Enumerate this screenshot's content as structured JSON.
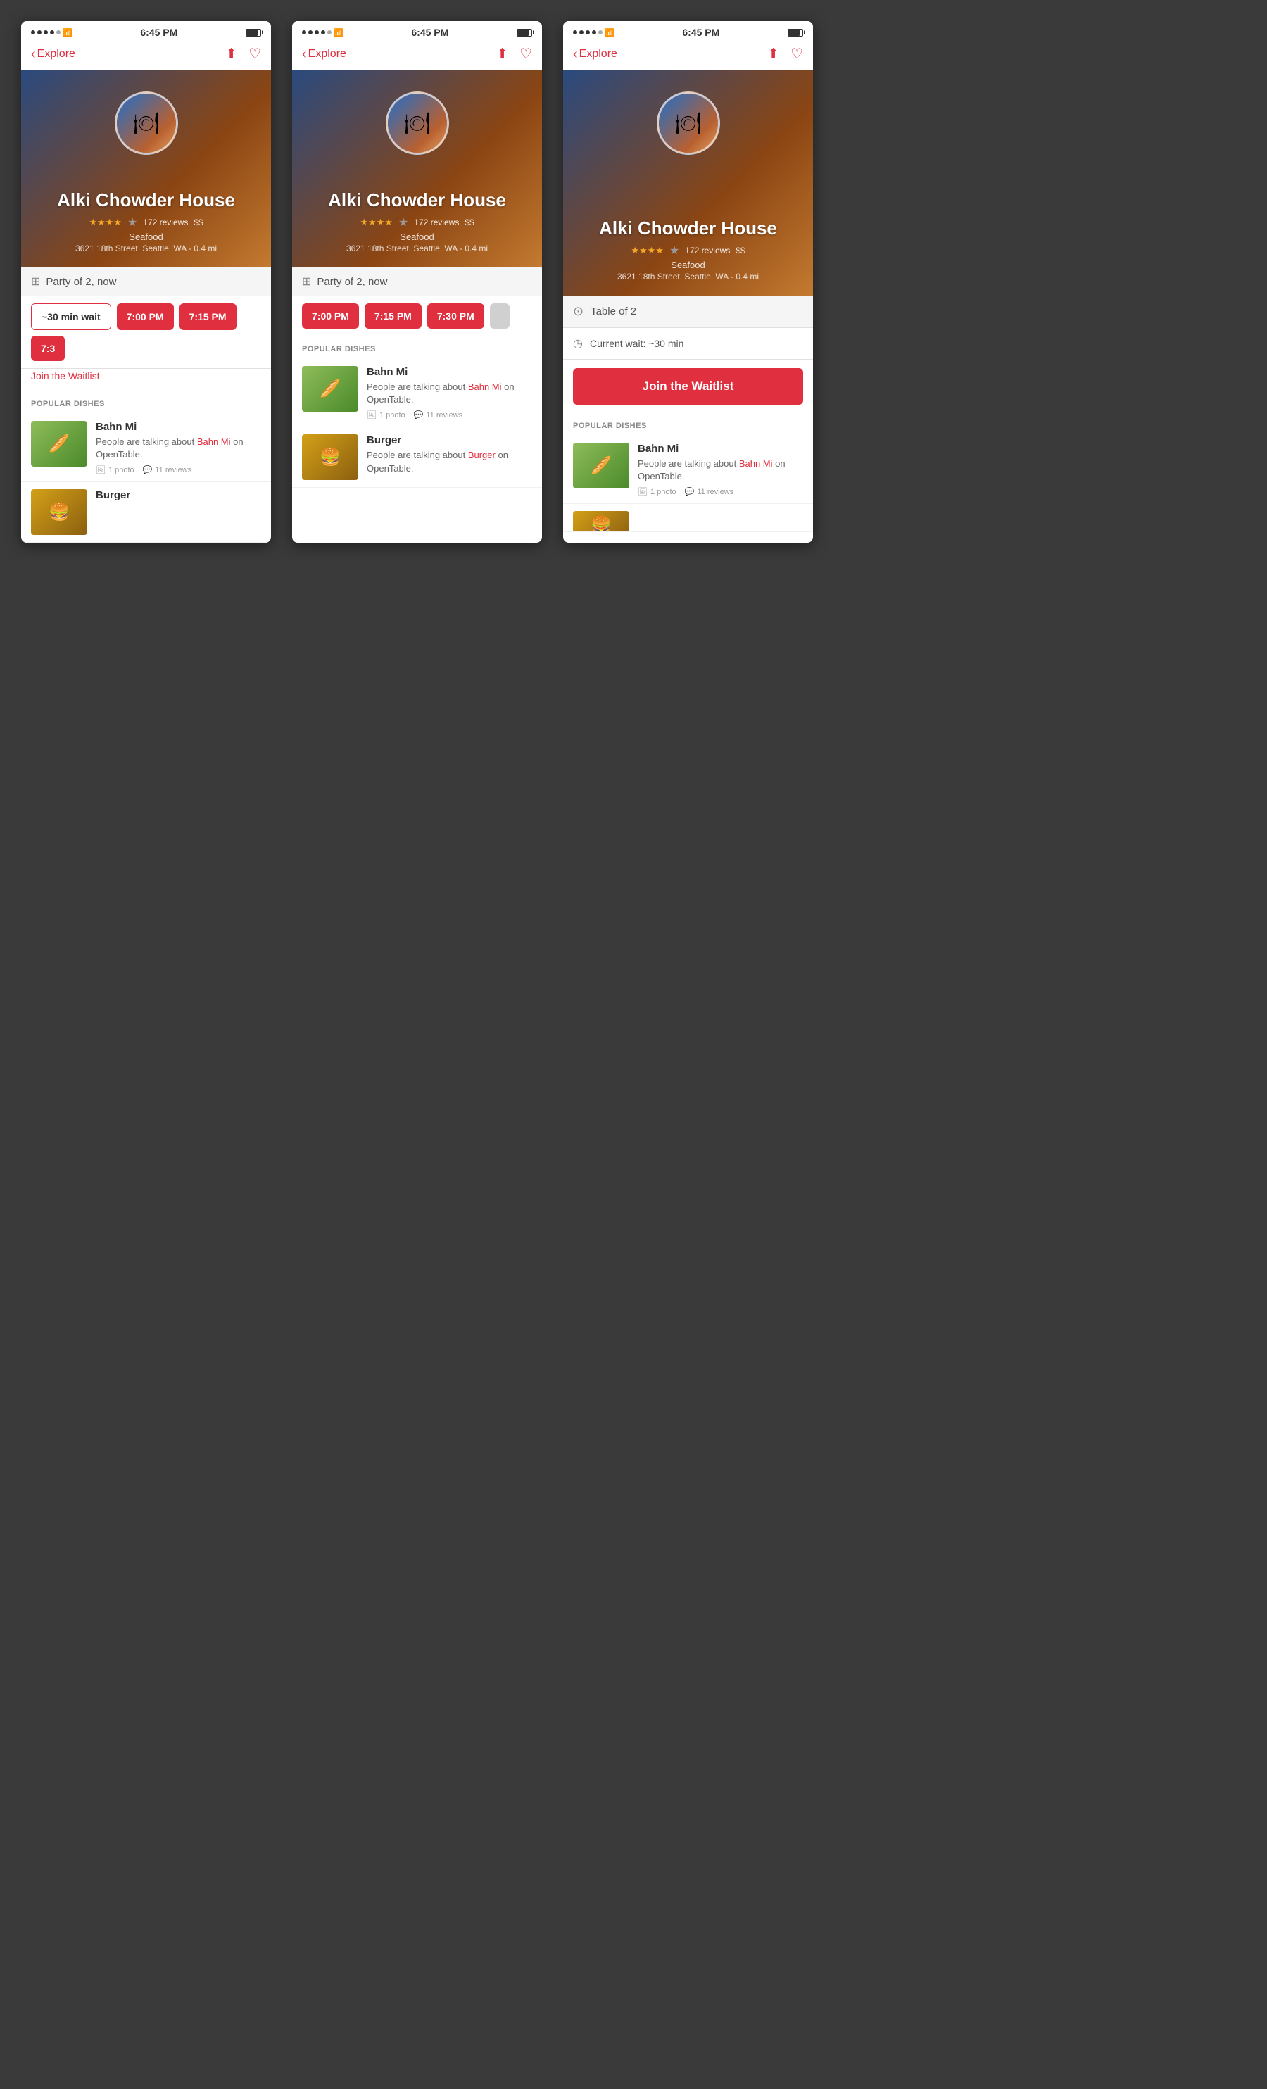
{
  "phones": [
    {
      "id": "phone-1",
      "status": {
        "time": "6:45 PM",
        "signal_dots": 4,
        "wifi": true,
        "battery": 80
      },
      "nav": {
        "back_label": "Explore",
        "share": true,
        "favorite": true
      },
      "restaurant": {
        "name": "Alki Chowder House",
        "rating": 3.5,
        "max_rating": 5,
        "reviews": "172 reviews",
        "price": "$$",
        "cuisine": "Seafood",
        "address": "3621 18th Street, Seattle, WA - 0.4 mi"
      },
      "booking": {
        "party": "Party of 2, now",
        "slots": [
          {
            "label": "~30 min wait",
            "style": "outline"
          },
          {
            "label": "7:00 PM",
            "style": "filled"
          },
          {
            "label": "7:15 PM",
            "style": "filled"
          },
          {
            "label": "7:3",
            "style": "filled"
          }
        ],
        "waitlist_link": "Join the Waitlist"
      },
      "dishes": {
        "section_label": "Popular Dishes",
        "items": [
          {
            "name": "Bahn Mi",
            "desc_before": "People are talking about ",
            "desc_link": "Bahn Mi",
            "desc_after": " on OpenTable.",
            "photos": "1 photo",
            "reviews": "11 reviews",
            "thumb_type": "sandwich"
          },
          {
            "name": "Burger",
            "desc_before": "",
            "desc_link": "",
            "desc_after": "",
            "thumb_type": "burger"
          }
        ]
      }
    },
    {
      "id": "phone-2",
      "status": {
        "time": "6:45 PM",
        "signal_dots": 4,
        "wifi": true,
        "battery": 80
      },
      "nav": {
        "back_label": "Explore",
        "share": true,
        "favorite": true
      },
      "restaurant": {
        "name": "Alki Chowder House",
        "rating": 3.5,
        "max_rating": 5,
        "reviews": "172 reviews",
        "price": "$$",
        "cuisine": "Seafood",
        "address": "3621 18th Street, Seattle, WA - 0.4 mi"
      },
      "booking": {
        "party": "Party of 2, now",
        "slots": [
          {
            "label": "7:00 PM",
            "style": "filled"
          },
          {
            "label": "7:15 PM",
            "style": "filled"
          },
          {
            "label": "7:30 PM",
            "style": "filled"
          },
          {
            "label": "",
            "style": "gray"
          }
        ]
      },
      "dishes": {
        "section_label": "Popular Dishes",
        "items": [
          {
            "name": "Bahn Mi",
            "desc_before": "People are talking about ",
            "desc_link": "Bahn Mi",
            "desc_after": " on OpenTable.",
            "photos": "1 photo",
            "reviews": "11 reviews",
            "thumb_type": "sandwich"
          },
          {
            "name": "Burger",
            "desc_before": "People are talking about ",
            "desc_link": "Burger",
            "desc_after": " on OpenTable.",
            "thumb_type": "burger"
          }
        ]
      }
    },
    {
      "id": "phone-3",
      "status": {
        "time": "6:45 PM",
        "signal_dots": 4,
        "wifi": true,
        "battery": 80
      },
      "nav": {
        "back_label": "Explore",
        "share": true,
        "favorite": true
      },
      "restaurant": {
        "name": "Alki Chowder House",
        "rating": 3.5,
        "max_rating": 5,
        "reviews": "172 reviews",
        "price": "$$",
        "cuisine": "Seafood",
        "address": "3621 18th Street, Seattle, WA - 0.4 mi"
      },
      "waitlist": {
        "table_label": "Table of 2",
        "current_wait_label": "Current wait: ~30 min",
        "join_label": "Join the Waitlist"
      },
      "dishes": {
        "section_label": "Popular Dishes",
        "items": [
          {
            "name": "Bahn Mi",
            "desc_before": "People are talking about ",
            "desc_link": "Bahn Mi",
            "desc_after": " on OpenTable.",
            "photos": "1 photo",
            "reviews": "11 reviews",
            "thumb_type": "sandwich"
          }
        ]
      }
    }
  ],
  "accent_color": "#e03040",
  "star_color": "#f5a623",
  "back_label": "Explore",
  "share_icon": "↑",
  "heart_icon": "♡",
  "table_icon": "⊞",
  "clock_icon": "◷",
  "person_icon": "⊙",
  "photo_icon": "🖼",
  "comment_icon": "💬"
}
